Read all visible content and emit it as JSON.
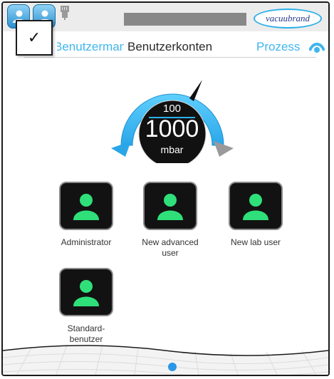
{
  "brand": {
    "name": "vacuubrand"
  },
  "popup": {
    "check": "✓"
  },
  "nav": {
    "previous": "Benutzermanager",
    "current": "Benutzerkonten",
    "next": "Prozess"
  },
  "gauge": {
    "setpoint": "100",
    "value": "1000",
    "unit": "mbar"
  },
  "users": [
    {
      "label": "Administrator"
    },
    {
      "label": "New advanced user"
    },
    {
      "label": "New lab user"
    },
    {
      "label": "Standard-benutzer"
    }
  ],
  "colors": {
    "accent": "#41b6ec",
    "user_icon": "#2fe07a",
    "tile_bg": "#121212",
    "page_dot": "#2b96e6"
  },
  "icons": [
    "user-icon",
    "user-icon",
    "network-icon",
    "eye-icon",
    "user-icon"
  ]
}
